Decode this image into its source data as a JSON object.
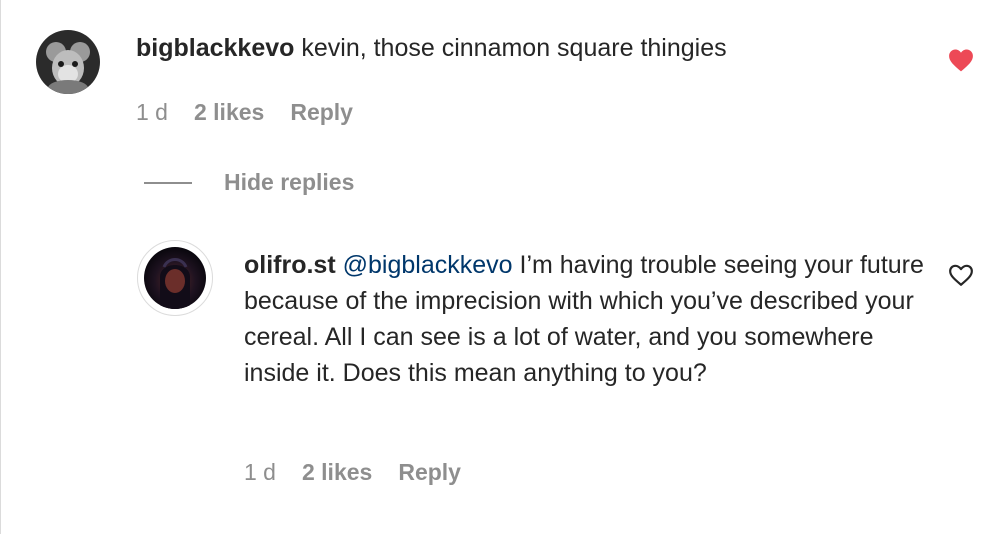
{
  "comment": {
    "username": "bigblackkevo",
    "text": "kevin, those cinnamon square thingies",
    "time": "1 d",
    "likes": "2 likes",
    "reply_label": "Reply",
    "liked": true,
    "heart_color": "#ed4956",
    "avatar_icon": "avatar-image"
  },
  "replies_toggle": {
    "label": "Hide replies"
  },
  "reply": {
    "username": "olifro.st",
    "mention": "@bigblackkevo",
    "text": "I’m having trouble seeing your future because of the imprecision with which you’ve described your cereal. All I can see is a lot of water, and you somewhere inside it. Does this mean anything to you?",
    "time": "1 d",
    "likes": "2 likes",
    "reply_label": "Reply",
    "liked": false,
    "avatar_icon": "avatar-image"
  },
  "colors": {
    "text": "#262626",
    "secondary": "#8e8e8e",
    "mention": "#00376b",
    "like_red": "#ed4956"
  }
}
